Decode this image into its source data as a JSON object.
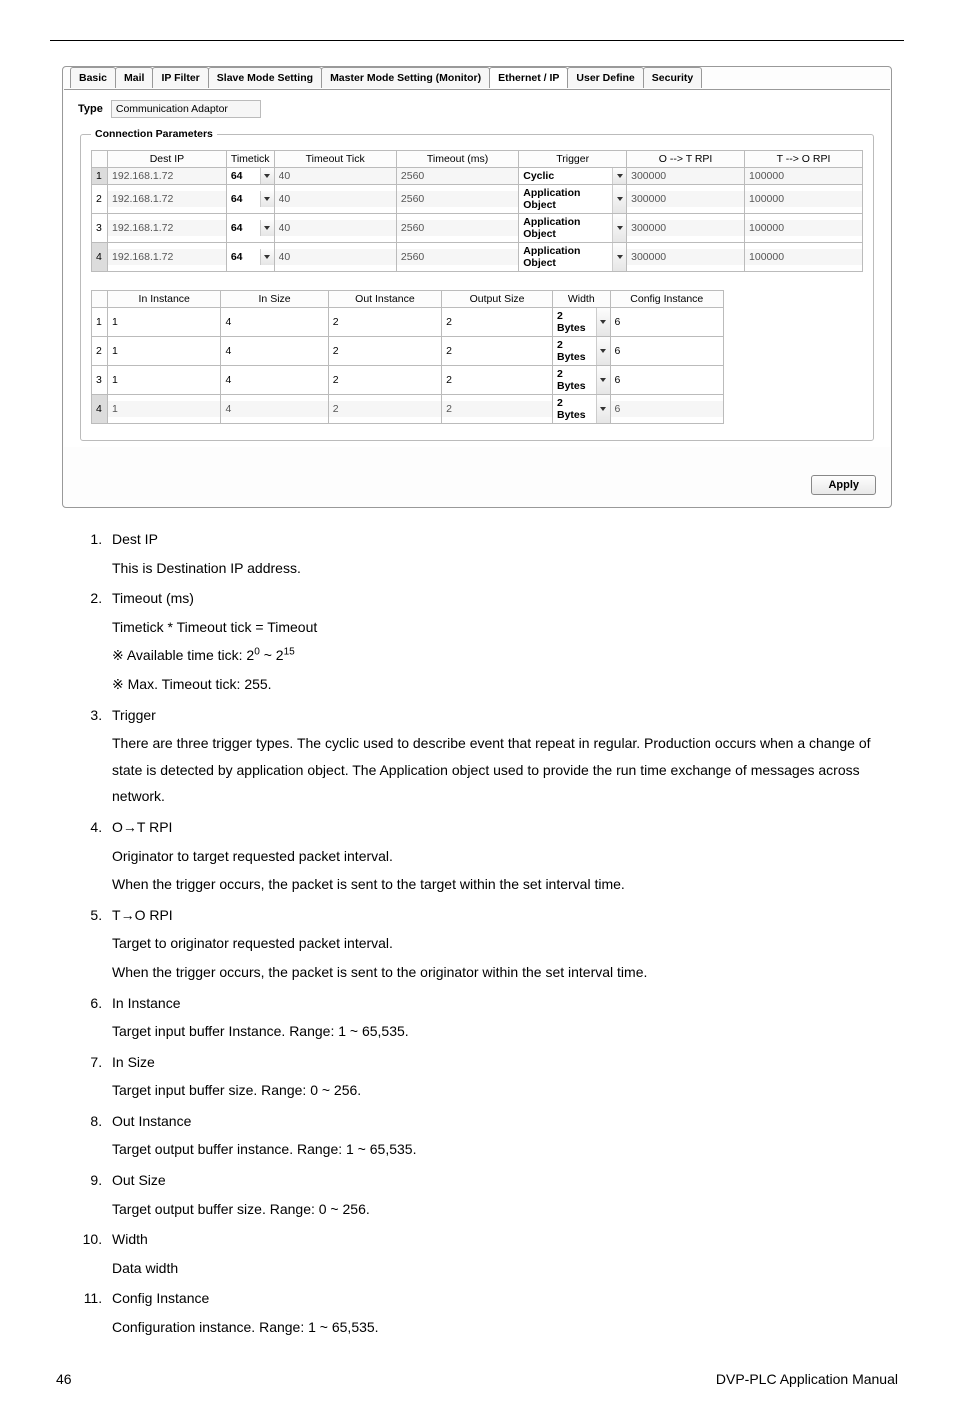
{
  "tabs": [
    "Basic",
    "Mail",
    "IP Filter",
    "Slave Mode Setting",
    "Master Mode Setting (Monitor)",
    "Ethernet / IP",
    "User Define",
    "Security"
  ],
  "active_tab": "Ethernet / IP",
  "type_label": "Type",
  "type_value": "Communication Adaptor",
  "legend": "Connection Parameters",
  "table1": {
    "headers": [
      "",
      "Dest IP",
      "Timetick",
      "Timeout Tick",
      "Timeout (ms)",
      "Trigger",
      "O --> T RPI",
      "T --> O RPI"
    ],
    "rows": [
      {
        "idx": "1",
        "dest": "192.168.1.72",
        "tick": "64",
        "tout": "40",
        "ms": "2560",
        "trig": "Cyclic",
        "ot": "300000",
        "to": "100000"
      },
      {
        "idx": "2",
        "dest": "192.168.1.72",
        "tick": "64",
        "tout": "40",
        "ms": "2560",
        "trig": "Application Object",
        "ot": "300000",
        "to": "100000"
      },
      {
        "idx": "3",
        "dest": "192.168.1.72",
        "tick": "64",
        "tout": "40",
        "ms": "2560",
        "trig": "Application Object",
        "ot": "300000",
        "to": "100000"
      },
      {
        "idx": "4",
        "dest": "192.168.1.72",
        "tick": "64",
        "tout": "40",
        "ms": "2560",
        "trig": "Application Object",
        "ot": "300000",
        "to": "100000"
      }
    ]
  },
  "table2": {
    "headers": [
      "",
      "In Instance",
      "In Size",
      "Out Instance",
      "Output Size",
      "Width",
      "Config Instance"
    ],
    "rows": [
      {
        "idx": "1",
        "inin": "1",
        "insz": "4",
        "outin": "2",
        "outsz": "2",
        "w": "2 Bytes",
        "cfg": "6"
      },
      {
        "idx": "2",
        "inin": "1",
        "insz": "4",
        "outin": "2",
        "outsz": "2",
        "w": "2 Bytes",
        "cfg": "6"
      },
      {
        "idx": "3",
        "inin": "1",
        "insz": "4",
        "outin": "2",
        "outsz": "2",
        "w": "2 Bytes",
        "cfg": "6"
      },
      {
        "idx": "4",
        "inin": "1",
        "insz": "4",
        "outin": "2",
        "outsz": "2",
        "w": "2 Bytes",
        "cfg": "6"
      }
    ]
  },
  "apply": "Apply",
  "desc": {
    "items": [
      {
        "t": "Dest IP",
        "b": [
          "This is Destination IP address."
        ]
      },
      {
        "t": "Timeout (ms)",
        "b": [
          "Timetick * Timeout tick = Timeout",
          "※ Available time tick: 2<sup>0</sup> ~ 2<sup>15</sup>",
          "※ Max. Timeout tick: 255."
        ]
      },
      {
        "t": "Trigger",
        "b": [
          "There are three trigger types. The cyclic used to describe event that repeat in regular. Production occurs when a change of state is detected by application object. The Application object used to provide the run time exchange of messages across network."
        ]
      },
      {
        "t": "O<span class='arrow'>→</span>T RPI",
        "b": [
          "Originator to target requested packet interval.",
          "When the trigger occurs, the packet is sent to the target within the set interval time."
        ]
      },
      {
        "t": "T<span class='arrow'>→</span>O RPI",
        "b": [
          "Target to originator requested packet interval.",
          "When the trigger occurs, the packet is sent to the originator within the set interval time."
        ]
      },
      {
        "t": "In Instance",
        "b": [
          "Target input buffer Instance. Range: 1 ~ 65,535."
        ]
      },
      {
        "t": "In Size",
        "b": [
          "Target input buffer size. Range: 0 ~ 256."
        ]
      },
      {
        "t": "Out Instance",
        "b": [
          "Target output buffer instance. Range: 1 ~ 65,535."
        ]
      },
      {
        "t": "Out Size",
        "b": [
          "Target output buffer size. Range: 0 ~ 256."
        ]
      },
      {
        "t": "Width",
        "b": [
          "Data width"
        ]
      },
      {
        "t": "Config Instance",
        "b": [
          "Configuration instance. Range: 1 ~ 65,535."
        ]
      }
    ]
  },
  "footer": {
    "page": "46",
    "title": "DVP-PLC Application Manual"
  }
}
